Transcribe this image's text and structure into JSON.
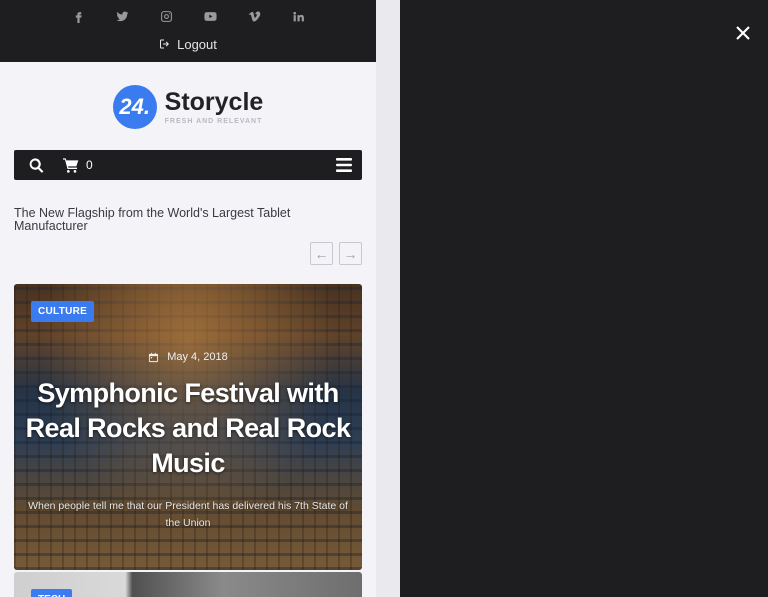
{
  "topbar": {
    "socials": [
      "facebook-icon",
      "twitter-icon",
      "instagram-icon",
      "youtube-icon",
      "vimeo-icon",
      "linkedin-icon"
    ],
    "logout_label": "Logout"
  },
  "logo": {
    "badge": "24.",
    "name": "Storycle",
    "tagline": "FRESH AND RELEVANT"
  },
  "navbar": {
    "cart_count": "0"
  },
  "ticker": {
    "headline": "The New Flagship from the World's Largest Tablet Manufacturer",
    "prev": "←",
    "next": "→"
  },
  "featured": {
    "category": "CULTURE",
    "date": "May 4, 2018",
    "title": "Symphonic Festival with Real Rocks and Real Rock Music",
    "excerpt": "When people tell me that our President has delivered his 7th State of the Union"
  },
  "next_card": {
    "category": "TECH"
  },
  "colors": {
    "accent": "#3a7bf0",
    "dark": "#1e1e21",
    "page_bg": "#f3f3f8"
  }
}
